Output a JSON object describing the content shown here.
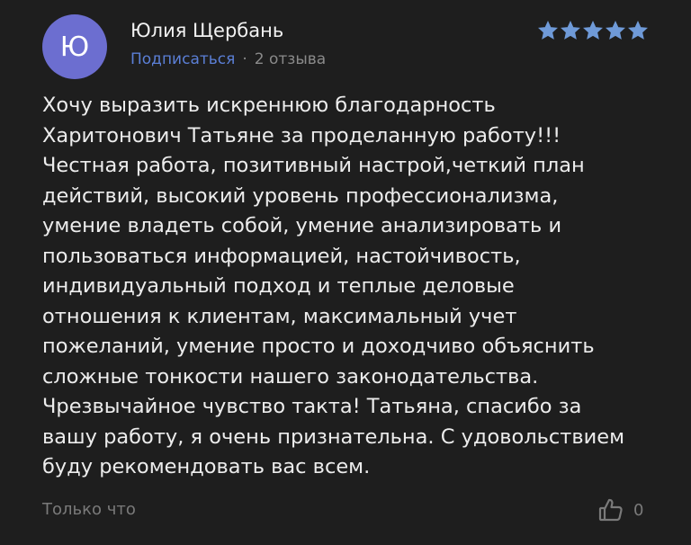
{
  "author": {
    "avatar_letter": "Ю",
    "name": "Юлия Щербань",
    "subscribe_label": "Подписаться",
    "separator": "·",
    "review_count": "2 отзыва"
  },
  "rating": {
    "stars": 5,
    "max_stars": 5,
    "star_color": "#6f9ad8"
  },
  "review": {
    "text": "Хочу выразить искреннюю благодарность\nХаритонович Татьяне за проделанную работу!!!\nЧестная работа, позитивный настрой,четкий план\nдействий, высокий уровень профессионализма,\nумение владеть собой, умение анализировать и\nпользоваться информацией, настойчивость,\nиндивидуальный подход и теплые деловые\nотношения к клиентам, максимальный учет\nпожеланий, умение просто и доходчиво объяснить\nсложные тонкости нашего законодательства.\nЧрезвычайное чувство такта! Татьяна, спасибо за\nвашу работу, я очень признательна. С удовольствием\nбуду рекомендовать вас всем."
  },
  "footer": {
    "timestamp": "Только что",
    "like_icon": "thumbs-up-icon",
    "like_count": "0"
  },
  "colors": {
    "background": "#1e1e1e",
    "avatar_bg": "#6c6ed0",
    "accent_link": "#5b7fd6",
    "muted_text": "#7a7a7a"
  }
}
